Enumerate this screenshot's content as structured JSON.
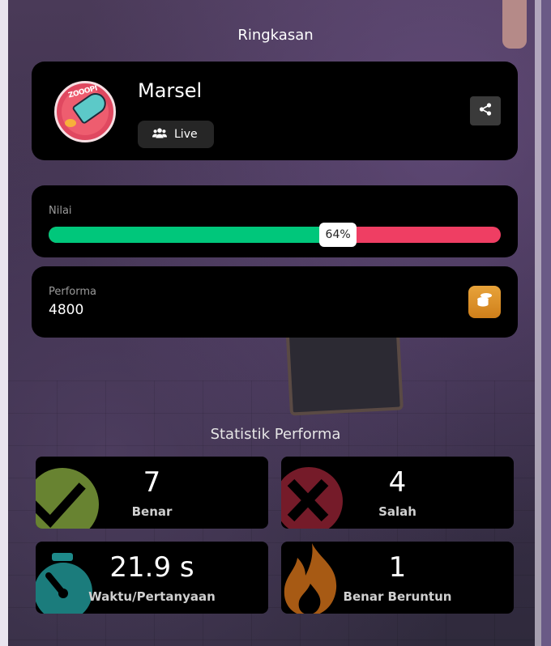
{
  "header": {
    "title": "Ringkasan"
  },
  "profile": {
    "name": "Marsel",
    "avatar_text": "ZOOOPI",
    "mode_label": "Live",
    "mode_icon": "users-icon",
    "share_icon": "share-icon"
  },
  "score": {
    "label": "Nilai",
    "percent_text": "64%",
    "percent": 64,
    "correct_color": "#00c77b",
    "wrong_color": "#ef3e63"
  },
  "performance": {
    "label": "Performa",
    "value": "4800",
    "icon": "coins-icon"
  },
  "stats_section": {
    "title": "Statistik Performa",
    "items": [
      {
        "value": "7",
        "label": "Benar",
        "icon": "check-icon",
        "color": "#7a9a3a"
      },
      {
        "value": "4",
        "label": "Salah",
        "icon": "cross-icon",
        "color": "#a9283a"
      },
      {
        "value": "21.9 s",
        "label": "Waktu/Pertanyaan",
        "icon": "timer-icon",
        "color": "#1e8a8a"
      },
      {
        "value": "1",
        "label": "Benar Beruntun",
        "icon": "flame-icon",
        "color": "#c46a18"
      }
    ]
  }
}
